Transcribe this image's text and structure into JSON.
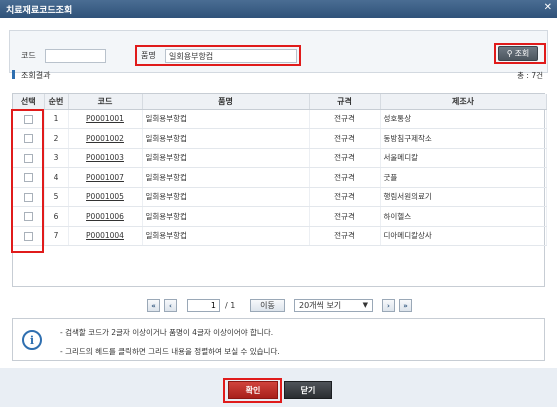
{
  "window": {
    "title": "치료재료코드조회",
    "close_icon": "close-icon"
  },
  "search": {
    "code_label": "코드",
    "code_value": "",
    "name_label": "품명",
    "name_value": "일회용부항컵",
    "button_label": "조회",
    "button_icon": "search-icon"
  },
  "results": {
    "title": "조회결과",
    "total": "총 : 7건",
    "columns": [
      "선택",
      "순번",
      "코드",
      "품명",
      "규격",
      "제조사"
    ],
    "rows": [
      {
        "no": "1",
        "code": "P0001001",
        "name": "일회용부항컵",
        "spec": "전규격",
        "maker": "성호통상"
      },
      {
        "no": "2",
        "code": "P0001002",
        "name": "일회용부항컵",
        "spec": "전규격",
        "maker": "동방침구제작소"
      },
      {
        "no": "3",
        "code": "P0001003",
        "name": "일회용부항컵",
        "spec": "전규격",
        "maker": "서울메디칼"
      },
      {
        "no": "4",
        "code": "P0001007",
        "name": "일회용부항컵",
        "spec": "전규격",
        "maker": "굿플"
      },
      {
        "no": "5",
        "code": "P0001005",
        "name": "일회용부항컵",
        "spec": "전규격",
        "maker": "행림서원의료기"
      },
      {
        "no": "6",
        "code": "P0001006",
        "name": "일회용부항컵",
        "spec": "전규격",
        "maker": "하이헬스"
      },
      {
        "no": "7",
        "code": "P0001004",
        "name": "일회용부항컵",
        "spec": "전규격",
        "maker": "디아메디칼상사"
      }
    ]
  },
  "pager": {
    "first": "«",
    "prev": "‹",
    "page": "1",
    "total": "/ 1",
    "go": "이동",
    "page_size": "20개씩 보기",
    "next": "›",
    "last": "»"
  },
  "info": {
    "icon": "info-icon",
    "lines": [
      "- 검색할 코드가 2글자 이상이거나 품명이 4글자 이상이어야 합니다.",
      "- 그리드의 헤드를 클릭하면 그리드 내용을 정렬하여 보실 수 있습니다."
    ]
  },
  "footer": {
    "confirm": "확인",
    "close": "닫기"
  },
  "colors": {
    "titlebar": "#2f5279",
    "highlight": "#e01b1b",
    "confirm": "#c0302a",
    "close": "#3a3d42"
  }
}
